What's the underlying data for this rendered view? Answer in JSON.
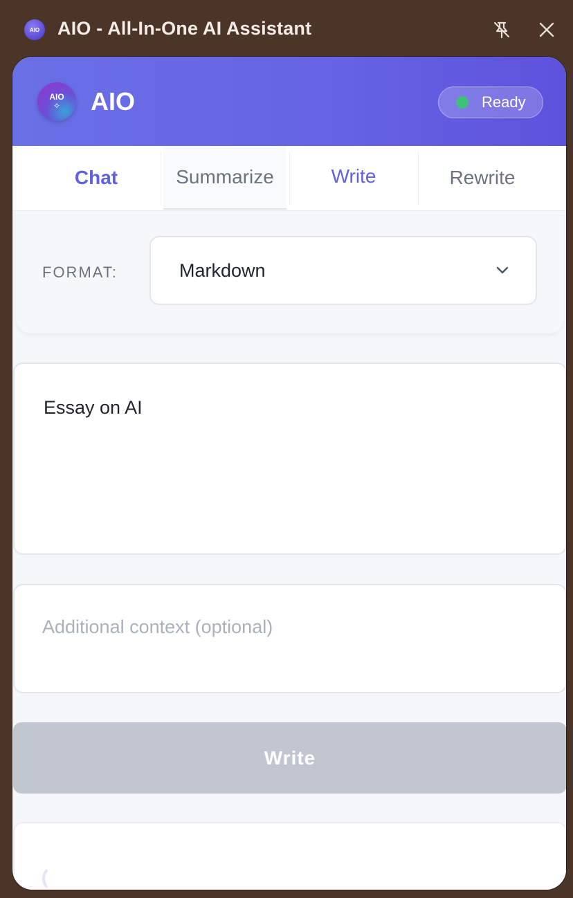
{
  "window": {
    "title": "AIO - All-In-One AI Assistant",
    "app_icon_text": "AIO"
  },
  "header": {
    "logo_line1": "AIO",
    "logo_line2": "✧",
    "brand": "AIO",
    "status": "Ready",
    "status_color": "#3fbf7a",
    "accent": "#6366e5"
  },
  "tabs": [
    {
      "label": "Chat"
    },
    {
      "label": "Summarize"
    },
    {
      "label": "Write"
    },
    {
      "label": "Rewrite"
    }
  ],
  "format": {
    "label": "FORMAT:",
    "selected": "Markdown"
  },
  "prompt": {
    "value": "Essay on AI"
  },
  "context": {
    "placeholder": "Additional context (optional)"
  },
  "actions": {
    "write_label": "Write"
  }
}
